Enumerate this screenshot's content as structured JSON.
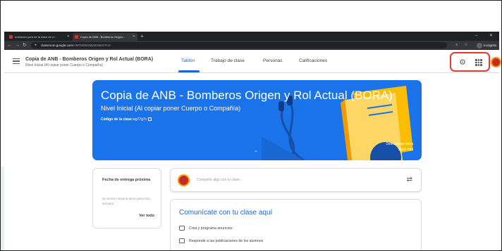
{
  "browser": {
    "tabs": [
      {
        "label": "Invitación para de la clase de cl..."
      },
      {
        "label": "Copia de ANB - Bomberos Origen..."
      }
    ],
    "new_tab": "+",
    "address": {
      "host": "classroom.google.com",
      "path": "/c/MTM0MzMyMzM5OTU3"
    },
    "profile_label": "Incógnito"
  },
  "header": {
    "class_title": "Copia de ANB - Bomberos Origen y Rol Actual (BORA)",
    "class_subtitle": "Nivel Inicial (Al copiar poner Cuerpo o Compañía)",
    "tabs": [
      {
        "label": "Tablón"
      },
      {
        "label": "Trabajo de clase"
      },
      {
        "label": "Personas"
      },
      {
        "label": "Calificaciones"
      }
    ]
  },
  "banner": {
    "title": "Copia de ANB - Bomberos Origen y Rol Actual (BORA)",
    "subtitle": "Nivel Inicial (Al copiar poner Cuerpo o Compañía)",
    "code_label": "Código de la clase",
    "code_value": "wg77g7c",
    "select_theme": "Seleccionar tema",
    "upload_photo": "Subir foto"
  },
  "upcoming": {
    "title": "Fecha de entrega próxima",
    "empty": "No tienes ninguna tarea para esta semana",
    "view_all": "Ver todo"
  },
  "share": {
    "placeholder": "Comparte algo con tu clase..."
  },
  "communicate": {
    "title": "Comunícate con tu clase aquí",
    "items": [
      {
        "label": "Crea y programa anuncios."
      },
      {
        "label": "Responde a las publicaciones de los alumnos"
      }
    ]
  },
  "colors": {
    "accent": "#1967d2",
    "banner": "#1a73e8",
    "highlight": "#e03b2f"
  }
}
